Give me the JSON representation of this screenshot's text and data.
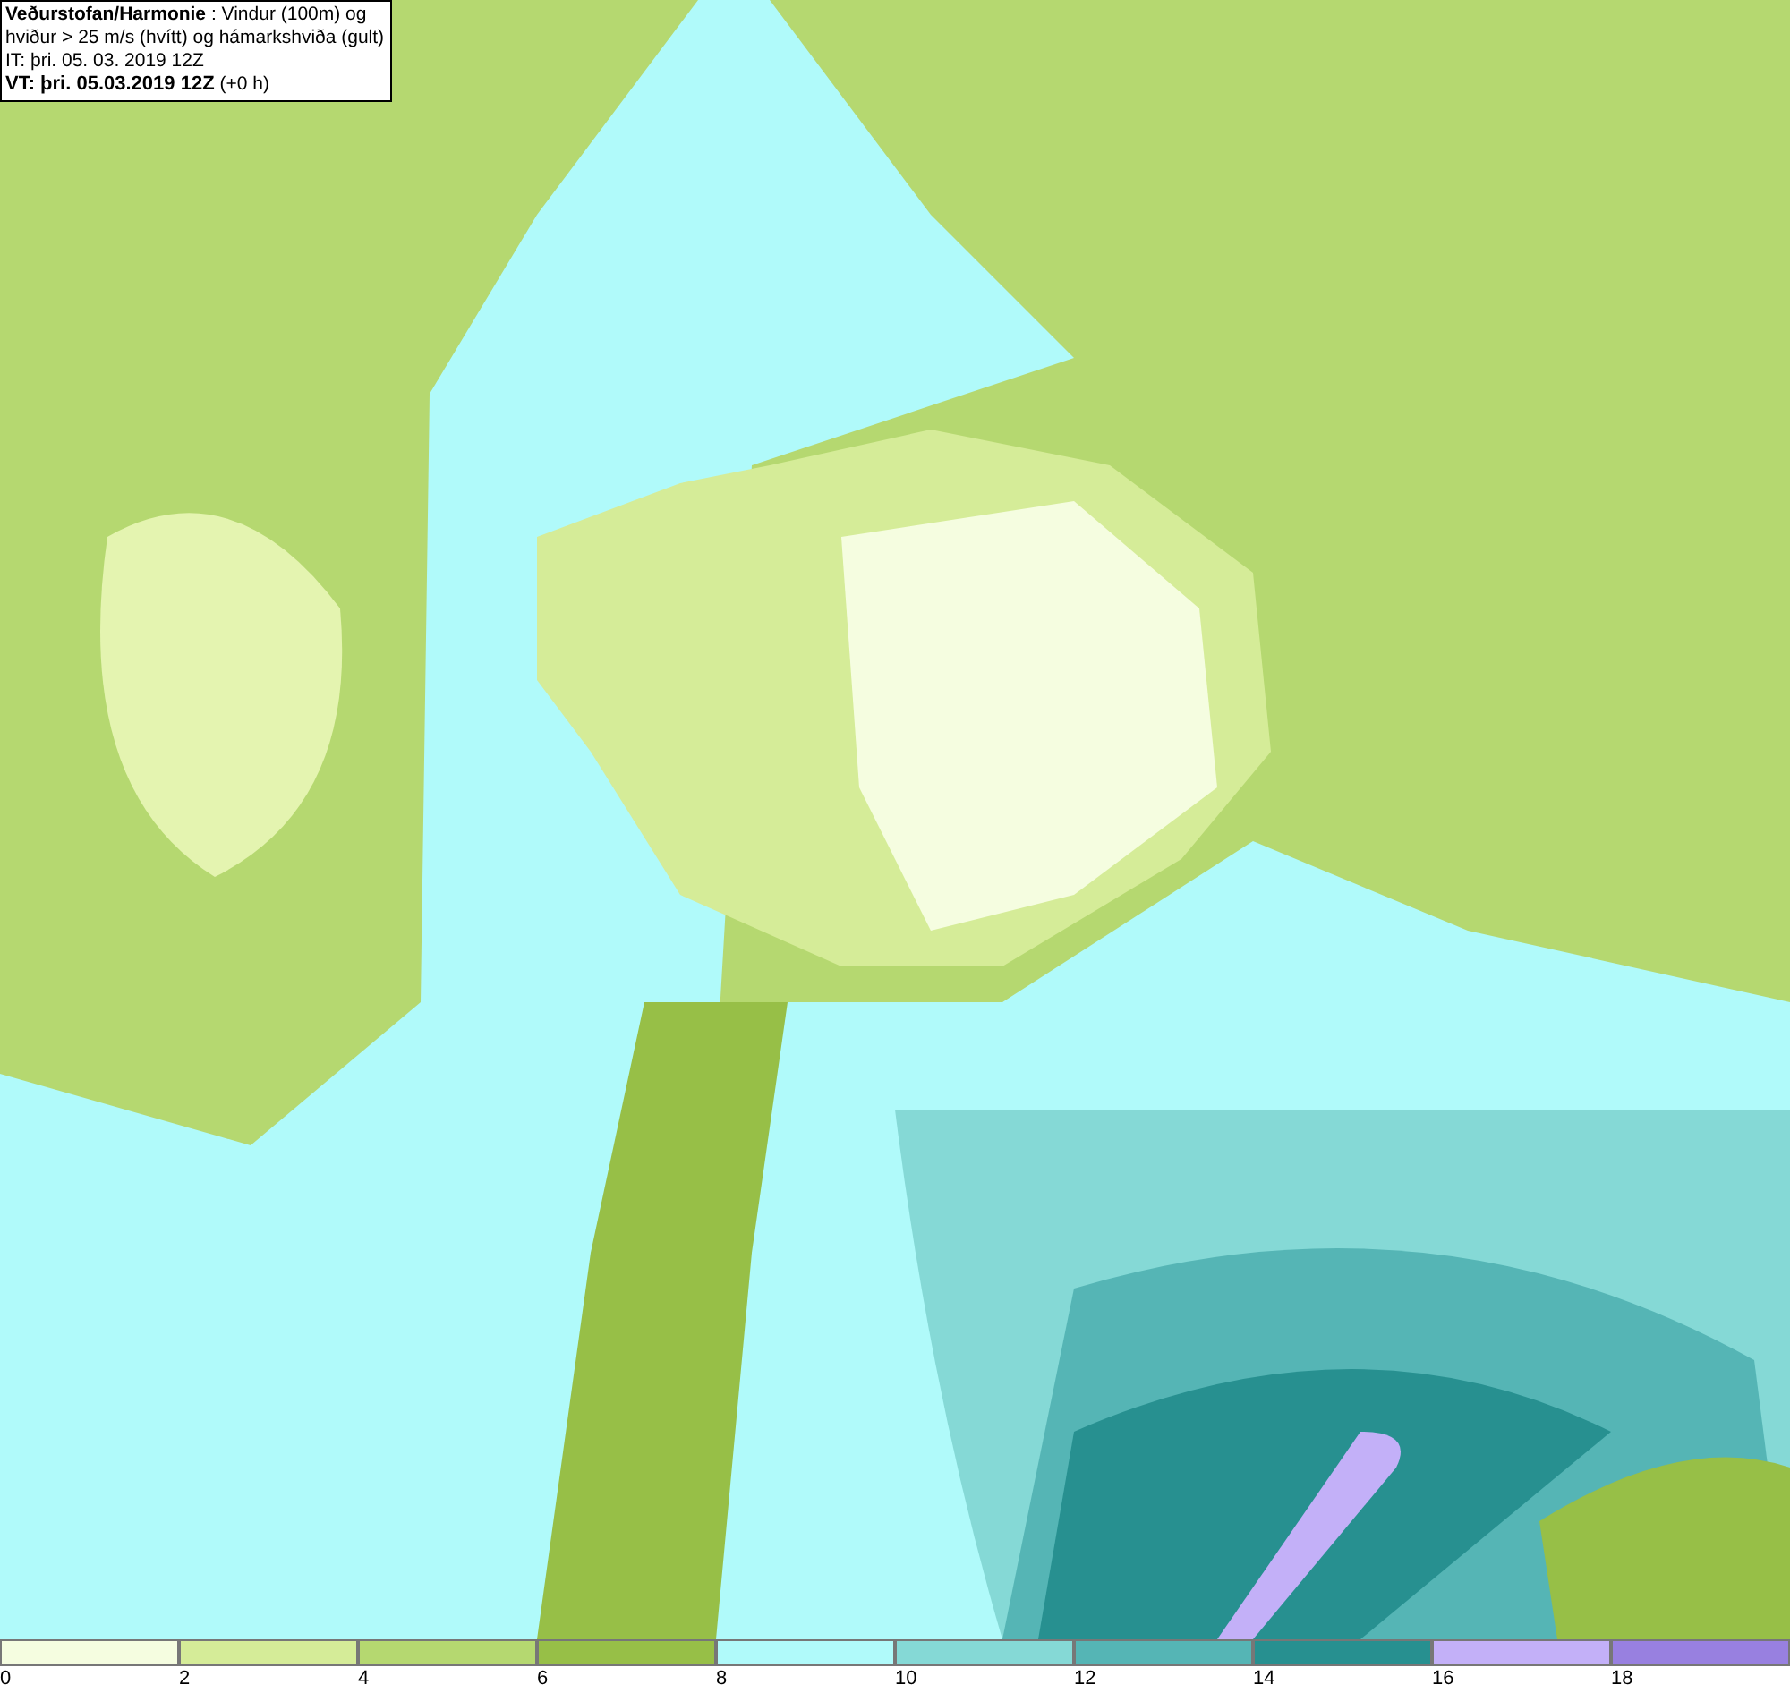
{
  "title_box": {
    "lines": [
      "**Veðurstofan/Harmonie** : Vindur (100m) og",
      "hviður > 25 m/s (hvítt) og hámarkshviða (gult)",
      "IT: þri. 05. 03. 2019 12Z",
      "**VT: þri. 05.03.2019 12Z** (+0 h)"
    ]
  },
  "legend": {
    "bins": [
      {
        "label": "0",
        "color": "#f5fde0"
      },
      {
        "label": "2",
        "color": "#d5ec98"
      },
      {
        "label": "4",
        "color": "#b5d870"
      },
      {
        "label": "6",
        "color": "#97bf47"
      },
      {
        "label": "8",
        "color": "#b0fafa"
      },
      {
        "label": "10",
        "color": "#85d9d6"
      },
      {
        "label": "12",
        "color": "#55b5b5"
      },
      {
        "label": "14",
        "color": "#279090"
      },
      {
        "label": "16",
        "color": "#c3b0f8"
      },
      {
        "label": "18",
        "color": "#9880e0"
      }
    ]
  }
}
